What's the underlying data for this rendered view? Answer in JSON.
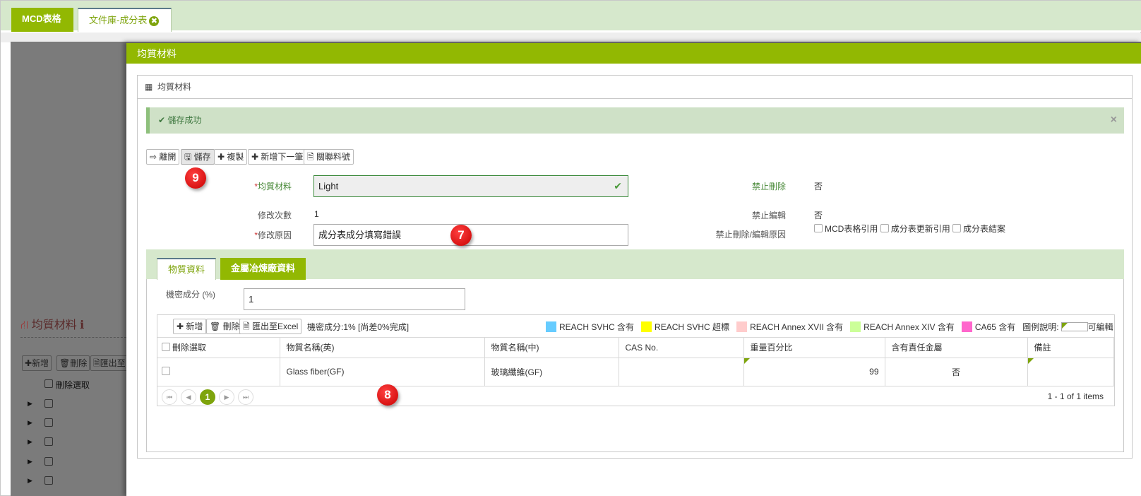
{
  "tabs": [
    {
      "label": "MCD表格"
    },
    {
      "label": "文件庫-成分表",
      "close_icon": "✖"
    }
  ],
  "background": {
    "title": "均質材料",
    "info_icon": "ℹ",
    "toolbar": [
      "新增",
      "刪除",
      "匯出至"
    ],
    "delete_select": "刪除選取",
    "rows": 5
  },
  "modal": {
    "title": "均質材料",
    "panel_title": "均質材料",
    "alert": {
      "text": "✔ 儲存成功",
      "close": "×"
    },
    "toolbar": [
      {
        "label": "⇨ 離開"
      },
      {
        "label": "🖫 儲存"
      },
      {
        "label": "✚ 複製"
      },
      {
        "label": "✚ 新增下一筆"
      },
      {
        "label": "🗎 關聯料號"
      }
    ],
    "badges": {
      "save": "9",
      "reason": "7",
      "table": "8"
    },
    "fields": {
      "material_label": "均質材料",
      "material_value": "Light",
      "revisions_label": "修改次數",
      "revisions_value": "1",
      "reason_label": "修改原因",
      "reason_value": "成分表成分填寫錯誤",
      "no_delete_label": "禁止刪除",
      "no_delete_value": "否",
      "no_edit_label": "禁止編輯",
      "no_edit_value": "否",
      "lock_reason_label": "禁止刪除/編輯原因",
      "lock_reasons": [
        "MCD表格引用",
        "成分表更新引用",
        "成分表結案"
      ]
    },
    "subtabs": [
      {
        "label": "物質資料"
      },
      {
        "label": "金屬冶煉廠資料"
      }
    ],
    "secret": {
      "label": "機密成分 (%)",
      "value": "1"
    },
    "grid": {
      "toolbar": [
        "✚ 新增",
        "🗑 刪除",
        "匯出至Excel"
      ],
      "status": "機密成分:1% [尚差0%完成]",
      "legend": [
        {
          "label": "REACH SVHC 含有",
          "color": "#66ccff"
        },
        {
          "label": "REACH SVHC 超標",
          "color": "#ffff00"
        },
        {
          "label": "REACH Annex XVII 含有",
          "color": "#ffcccc"
        },
        {
          "label": "REACH Annex XIV 含有",
          "color": "#ccff99"
        },
        {
          "label": "CA65 含有",
          "color": "#ff66cc"
        }
      ],
      "legend_note": "圖例說明:",
      "editable_label": "可編輯",
      "columns": [
        "刪除選取",
        "物質名稱(英)",
        "物質名稱(中)",
        "CAS No.",
        "重量百分比",
        "含有責任金屬",
        "備註"
      ],
      "rows": [
        {
          "name_en": "Glass fiber(GF)",
          "name_zh": "玻璃纖維(GF)",
          "cas": "",
          "weight": "99",
          "metal": "否",
          "note": ""
        }
      ],
      "pager": {
        "first": "⏮",
        "prev": "◀",
        "page": "1",
        "next": "▶",
        "last": "⏭",
        "info": "1 - 1 of 1 items"
      }
    }
  },
  "colors": {
    "brand": "#92b802",
    "tab_bg": "#d6e8cc",
    "alert_bg": "#cfe1c7"
  }
}
